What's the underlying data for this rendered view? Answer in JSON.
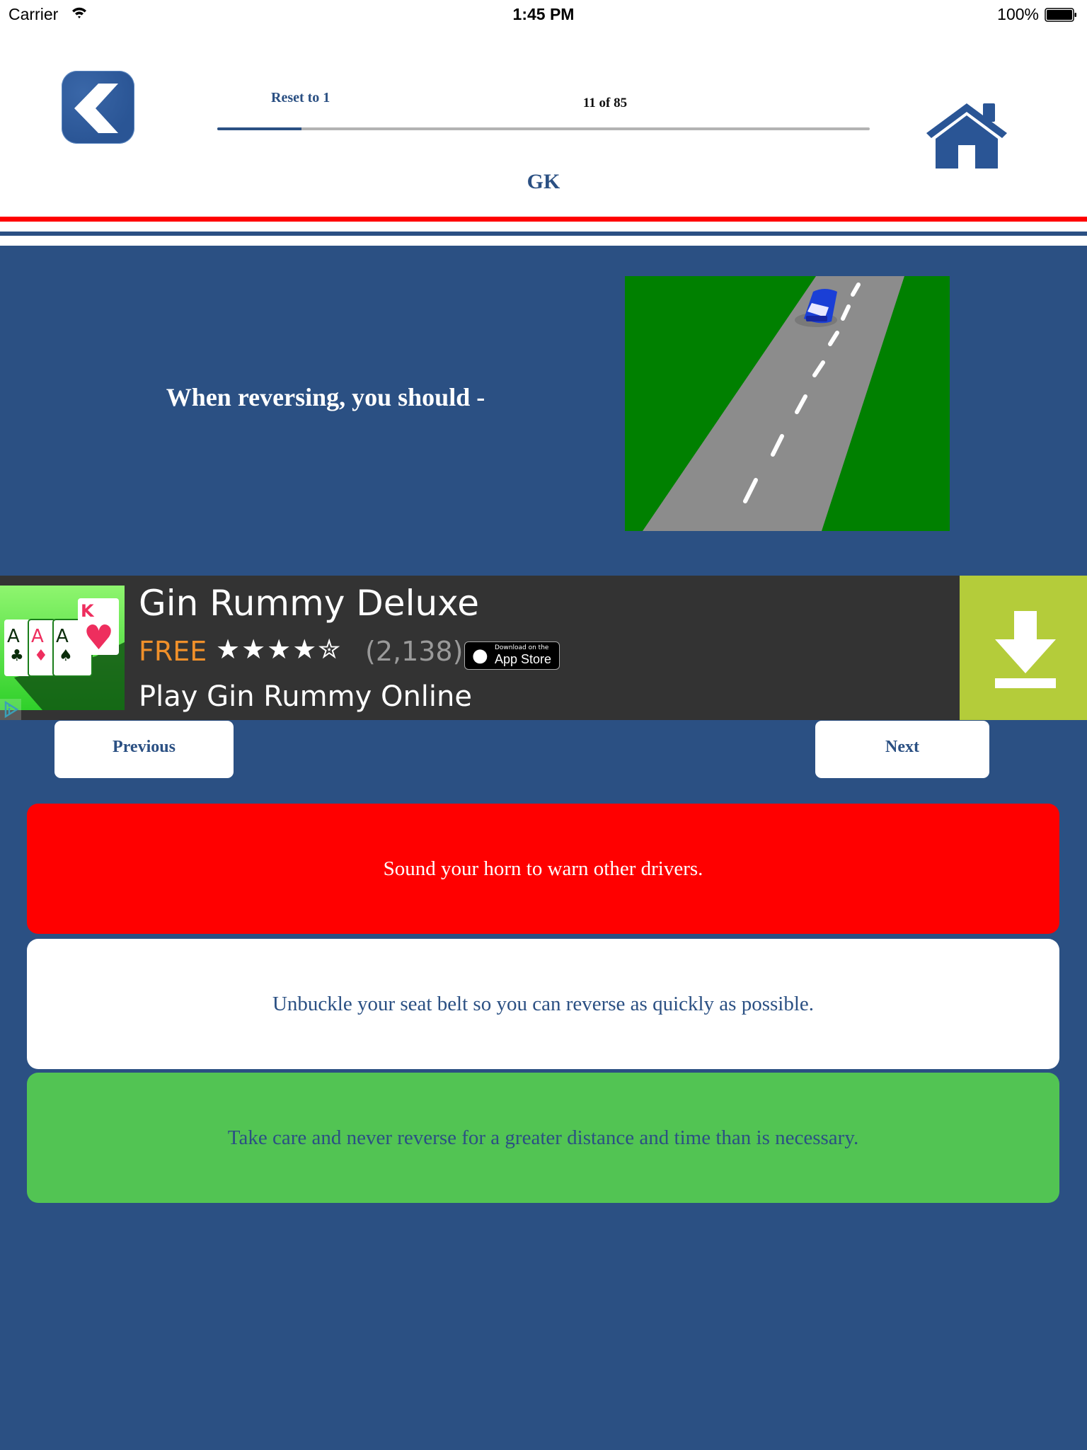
{
  "status_bar": {
    "carrier": "Carrier",
    "time": "1:45 PM",
    "battery": "100%"
  },
  "header": {
    "back_icon": "back-chevron-icon",
    "reset_label": "Reset to 1",
    "counter": "11 of 85",
    "progress": {
      "current": 11,
      "total": 85
    },
    "home_icon": "home-icon",
    "category": "GK"
  },
  "question": {
    "text": "When reversing, you should -",
    "image_description": "blue car on a grey road with dashed white center line, green grass on both sides"
  },
  "ad": {
    "title": "Gin Rummy Deluxe",
    "price": "FREE",
    "stars": "★★★★✮",
    "rating": 4.5,
    "reviews": "(2,138)",
    "appstore_small": "Download on the",
    "appstore_big": "App Store",
    "apple_glyph": "",
    "subtitle": "Play Gin Rummy Online",
    "download_icon": "download-icon",
    "adchoices_icon": "adchoices-icon"
  },
  "nav": {
    "previous_label": "Previous",
    "next_label": "Next"
  },
  "answers": [
    {
      "text": "Sound your horn to warn other drivers.",
      "state": "wrong",
      "color": "#ff0000"
    },
    {
      "text": "Unbuckle your seat belt so you can reverse as quickly as possible.",
      "state": "neutral",
      "color": "#ffffff"
    },
    {
      "text": "Take care and never reverse for a greater distance and time than is necessary.",
      "state": "correct",
      "color": "#52c453"
    }
  ],
  "colors": {
    "brand_blue": "#2b5083",
    "stripe_red": "#ff0000",
    "ad_green": "#b4cc3a",
    "ad_price": "#f0902a"
  }
}
